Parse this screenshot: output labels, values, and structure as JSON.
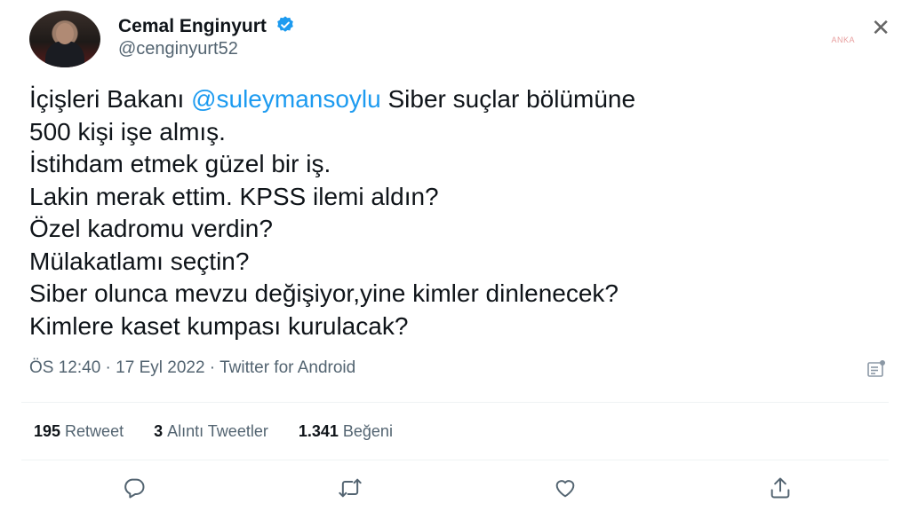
{
  "author": {
    "display_name": "Cemal Enginyurt",
    "handle": "@cenginyurt52",
    "verified": true
  },
  "watermark": "ANKA",
  "close_glyph": "✕",
  "tweet": {
    "line1_prefix": "İçişleri Bakanı ",
    "mention": "@suleymansoylu",
    "line1_suffix": " Siber suçlar bölümüne",
    "rest": "500 kişi işe almış.\nİstihdam etmek güzel bir iş.\nLakin merak ettim. KPSS ilemi aldın?\nÖzel kadromu verdin?\nMülakatlamı seçtin?\nSiber olunca mevzu değişiyor,yine kimler dinlenecek?\nKimlere kaset kumpası kurulacak?"
  },
  "meta": {
    "time": "ÖS 12:40",
    "separator": " · ",
    "date": "17 Eyl 2022",
    "source": "Twitter for Android"
  },
  "stats": {
    "retweets_count": "195",
    "retweets_label": "Retweet",
    "quotes_count": "3",
    "quotes_label": "Alıntı Tweetler",
    "likes_count": "1.341",
    "likes_label": "Beğeni"
  },
  "actions": [
    "reply-icon",
    "retweet-icon",
    "like-icon",
    "share-icon"
  ],
  "colors": {
    "accent": "#1d9bf0",
    "text": "#0f1419",
    "muted": "#536471"
  }
}
